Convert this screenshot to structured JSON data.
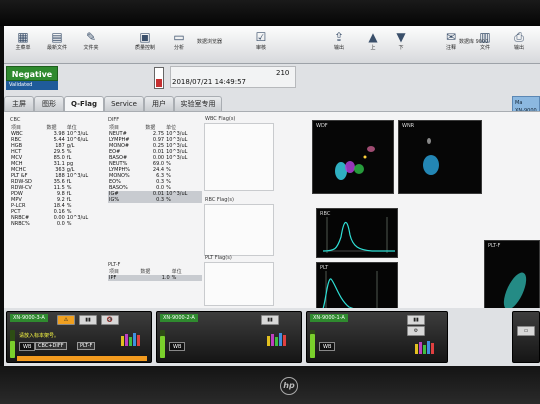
{
  "toolbar": {
    "title": "数据浏览器",
    "right_status": "数据库  9000",
    "buttons": [
      {
        "label": "主菜单",
        "icon": "home-icon"
      },
      {
        "label": "最新文件",
        "icon": "folder-icon"
      },
      {
        "label": "文件夹",
        "icon": "edit-icon"
      },
      {
        "label": "质量控制",
        "icon": "clipboard-icon"
      },
      {
        "label": "分析",
        "icon": "monitor-icon"
      },
      {
        "label": "审核",
        "icon": "validate-icon"
      },
      {
        "label": "输出",
        "icon": "output-icon"
      },
      {
        "label": "上",
        "icon": "up-arrow-icon"
      },
      {
        "label": "下",
        "icon": "down-arrow-icon"
      },
      {
        "label": "注释",
        "icon": "comment-icon"
      },
      {
        "label": "文件",
        "icon": "file-icon"
      },
      {
        "label": "输出",
        "icon": "print-icon"
      }
    ]
  },
  "sample": {
    "judgement": "Negative",
    "status": "Validated",
    "datetime": "2018/07/21 14:49:57",
    "number": "210"
  },
  "tabs": [
    "主屏",
    "图形",
    "Q-Flag",
    "Service",
    "用户",
    "实验室专用"
  ],
  "side_button": {
    "line1": "Ma",
    "line2": "XN-9000"
  },
  "cbc": {
    "title": "CBC",
    "headers": [
      "项目",
      "数据",
      "单位"
    ],
    "rows": [
      [
        "WBC",
        "3.98",
        "10^3/uL"
      ],
      [
        "RBC",
        "5.44",
        "10^6/uL"
      ],
      [
        "HGB",
        "187",
        "g/L"
      ],
      [
        "HCT",
        "29.5",
        "%"
      ],
      [
        "MCV",
        "85.0",
        "fL"
      ],
      [
        "MCH",
        "31.1",
        "pg"
      ],
      [
        "MCHC",
        "363",
        "g/L"
      ],
      [
        "PLT &F",
        "188",
        "10^3/uL"
      ],
      [
        "RDW-SD",
        "35.6",
        "fL"
      ],
      [
        "RDW-CV",
        "11.5",
        "%"
      ],
      [
        "PDW",
        "9.8",
        "fL"
      ],
      [
        "MPV",
        "9.2",
        "fL"
      ],
      [
        "P-LCR",
        "18.4",
        "%"
      ],
      [
        "PCT",
        "0.16",
        "%"
      ],
      [
        "NRBC#",
        "0.00",
        "10^3/uL"
      ],
      [
        "NRBC%",
        "0.0",
        "%"
      ]
    ]
  },
  "diff": {
    "title": "DIFF",
    "headers": [
      "项目",
      "数据",
      "单位"
    ],
    "rows": [
      [
        "NEUT#",
        "2.75",
        "10^3/uL"
      ],
      [
        "LYMPH#",
        "0.97",
        "10^3/uL"
      ],
      [
        "MONO#",
        "0.25",
        "10^3/uL"
      ],
      [
        "EO#",
        "0.01",
        "10^3/uL"
      ],
      [
        "BASO#",
        "0.00",
        "10^3/uL"
      ],
      [
        "NEUT%",
        "69.0",
        "%"
      ],
      [
        "LYMPH%",
        "24.4",
        "%"
      ],
      [
        "MONO%",
        "6.3",
        "%"
      ],
      [
        "EO%",
        "0.3",
        "%"
      ],
      [
        "BASO%",
        "0.0",
        "%"
      ],
      [
        "IG#",
        "0.01",
        "10^3/uL"
      ],
      [
        "IG%",
        "0.3",
        "%"
      ]
    ]
  },
  "plt_f": {
    "title": "PLT-F",
    "headers": [
      "项目",
      "数据",
      "单位"
    ],
    "rows": [
      [
        "IPF",
        "1.0",
        "%"
      ]
    ]
  },
  "flags": {
    "wbc": "WBC Flag(s)",
    "rbc": "RBC Flag(s)",
    "plt": "PLT Flag(s)"
  },
  "graphs": {
    "wdf": "WDF",
    "wnr": "WNR",
    "rbc": "RBC",
    "plt": "PLT",
    "pltf": "PLT-F"
  },
  "units": [
    {
      "id": "XN-9000-3-A",
      "message": "请放入标本架号。",
      "tags": [
        "WB",
        "CBC+DIFF",
        "PLT-F"
      ]
    },
    {
      "id": "XN-9000-2-A",
      "tags": [
        "WB"
      ]
    },
    {
      "id": "XN-9000-1-A",
      "tags": [
        "WB"
      ]
    }
  ]
}
